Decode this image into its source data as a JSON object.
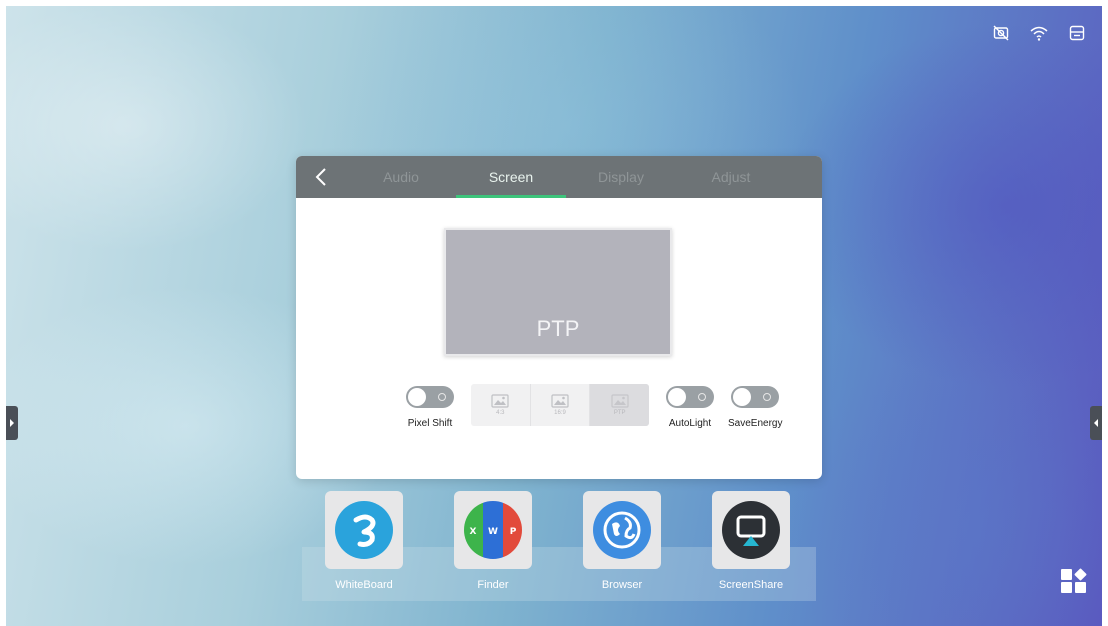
{
  "status_icons": [
    "camera-off-icon",
    "wifi-icon",
    "input-source-icon"
  ],
  "settings": {
    "tabs": [
      {
        "label": "Audio",
        "active": false
      },
      {
        "label": "Screen",
        "active": true
      },
      {
        "label": "Display",
        "active": false
      },
      {
        "label": "Adjust",
        "active": false
      }
    ],
    "preview_label": "PTP",
    "pixel_shift_label": "Pixel Shift",
    "ratio_options": [
      {
        "label": "4:3",
        "selected": false
      },
      {
        "label": "16:9",
        "selected": false
      },
      {
        "label": "PTP",
        "selected": true
      }
    ],
    "autolight_label": "AutoLight",
    "saveenergy_label": "SaveEnergy",
    "accent_color": "#3dc47b"
  },
  "dock": {
    "apps": [
      {
        "label": "WhiteBoard",
        "icon": "whiteboard-icon"
      },
      {
        "label": "Finder",
        "icon": "finder-icon"
      },
      {
        "label": "Browser",
        "icon": "browser-icon"
      },
      {
        "label": "ScreenShare",
        "icon": "screenshare-icon"
      }
    ]
  }
}
